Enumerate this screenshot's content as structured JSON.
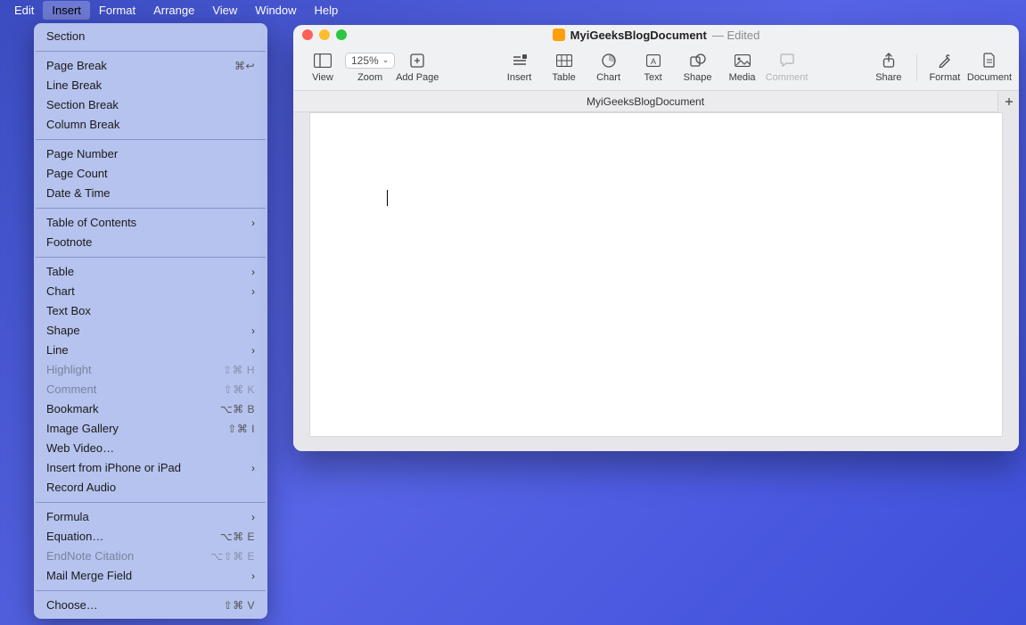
{
  "menubar": [
    "Edit",
    "Insert",
    "Format",
    "Arrange",
    "View",
    "Window",
    "Help"
  ],
  "menubar_active_index": 1,
  "dropdown": {
    "groups": [
      [
        {
          "label": "Section",
          "shortcut": "",
          "arrow": false,
          "disabled": false
        }
      ],
      [
        {
          "label": "Page Break",
          "shortcut": "⌘↩",
          "arrow": false,
          "disabled": false
        },
        {
          "label": "Line Break",
          "shortcut": "",
          "arrow": false,
          "disabled": false
        },
        {
          "label": "Section Break",
          "shortcut": "",
          "arrow": false,
          "disabled": false
        },
        {
          "label": "Column Break",
          "shortcut": "",
          "arrow": false,
          "disabled": false
        }
      ],
      [
        {
          "label": "Page Number",
          "shortcut": "",
          "arrow": false,
          "disabled": false
        },
        {
          "label": "Page Count",
          "shortcut": "",
          "arrow": false,
          "disabled": false
        },
        {
          "label": "Date & Time",
          "shortcut": "",
          "arrow": false,
          "disabled": false
        }
      ],
      [
        {
          "label": "Table of Contents",
          "shortcut": "",
          "arrow": true,
          "disabled": false
        },
        {
          "label": "Footnote",
          "shortcut": "",
          "arrow": false,
          "disabled": false
        }
      ],
      [
        {
          "label": "Table",
          "shortcut": "",
          "arrow": true,
          "disabled": false
        },
        {
          "label": "Chart",
          "shortcut": "",
          "arrow": true,
          "disabled": false
        },
        {
          "label": "Text Box",
          "shortcut": "",
          "arrow": false,
          "disabled": false
        },
        {
          "label": "Shape",
          "shortcut": "",
          "arrow": true,
          "disabled": false
        },
        {
          "label": "Line",
          "shortcut": "",
          "arrow": true,
          "disabled": false
        },
        {
          "label": "Highlight",
          "shortcut": "⇧⌘ H",
          "arrow": false,
          "disabled": true
        },
        {
          "label": "Comment",
          "shortcut": "⇧⌘ K",
          "arrow": false,
          "disabled": true
        },
        {
          "label": "Bookmark",
          "shortcut": "⌥⌘ B",
          "arrow": false,
          "disabled": false
        },
        {
          "label": "Image Gallery",
          "shortcut": "⇧⌘ I",
          "arrow": false,
          "disabled": false
        },
        {
          "label": "Web Video…",
          "shortcut": "",
          "arrow": false,
          "disabled": false
        },
        {
          "label": "Insert from iPhone or iPad",
          "shortcut": "",
          "arrow": true,
          "disabled": false
        },
        {
          "label": "Record Audio",
          "shortcut": "",
          "arrow": false,
          "disabled": false
        }
      ],
      [
        {
          "label": "Formula",
          "shortcut": "",
          "arrow": true,
          "disabled": false
        },
        {
          "label": "Equation…",
          "shortcut": "⌥⌘ E",
          "arrow": false,
          "disabled": false
        },
        {
          "label": "EndNote Citation",
          "shortcut": "⌥⇧⌘ E",
          "arrow": false,
          "disabled": true
        },
        {
          "label": "Mail Merge Field",
          "shortcut": "",
          "arrow": true,
          "disabled": false
        }
      ],
      [
        {
          "label": "Choose…",
          "shortcut": "⇧⌘ V",
          "arrow": false,
          "disabled": false
        }
      ]
    ]
  },
  "window": {
    "title": "MyiGeeksBlogDocument",
    "status": "— Edited",
    "zoom": "125%",
    "tab_name": "MyiGeeksBlogDocument",
    "toolbar": {
      "view": "View",
      "zoom": "Zoom",
      "add_page": "Add Page",
      "insert": "Insert",
      "table": "Table",
      "chart": "Chart",
      "text": "Text",
      "shape": "Shape",
      "media": "Media",
      "comment": "Comment",
      "share": "Share",
      "format": "Format",
      "document": "Document"
    }
  }
}
